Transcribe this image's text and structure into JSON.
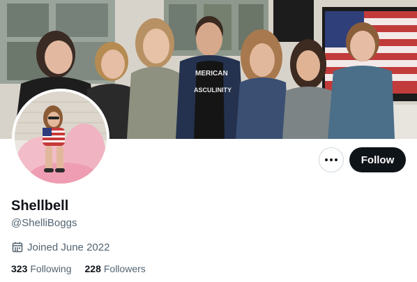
{
  "profile": {
    "display_name": "Shellbell",
    "handle": "@ShelliBoggs",
    "joined": "Joined June 2022",
    "joined_icon": "calendar-icon"
  },
  "stats": {
    "following_count": "323",
    "following_label": "Following",
    "followers_count": "228",
    "followers_label": "Followers"
  },
  "actions": {
    "more_icon": "more-icon",
    "follow_label": "Follow"
  },
  "banner": {
    "shirt_text_line1": "MERICAN",
    "shirt_text_line2": "ASCULINITY"
  },
  "colors": {
    "text_primary": "#0f1419",
    "text_secondary": "#536471",
    "button_dark": "#0f1419",
    "border": "#cfd9de"
  }
}
